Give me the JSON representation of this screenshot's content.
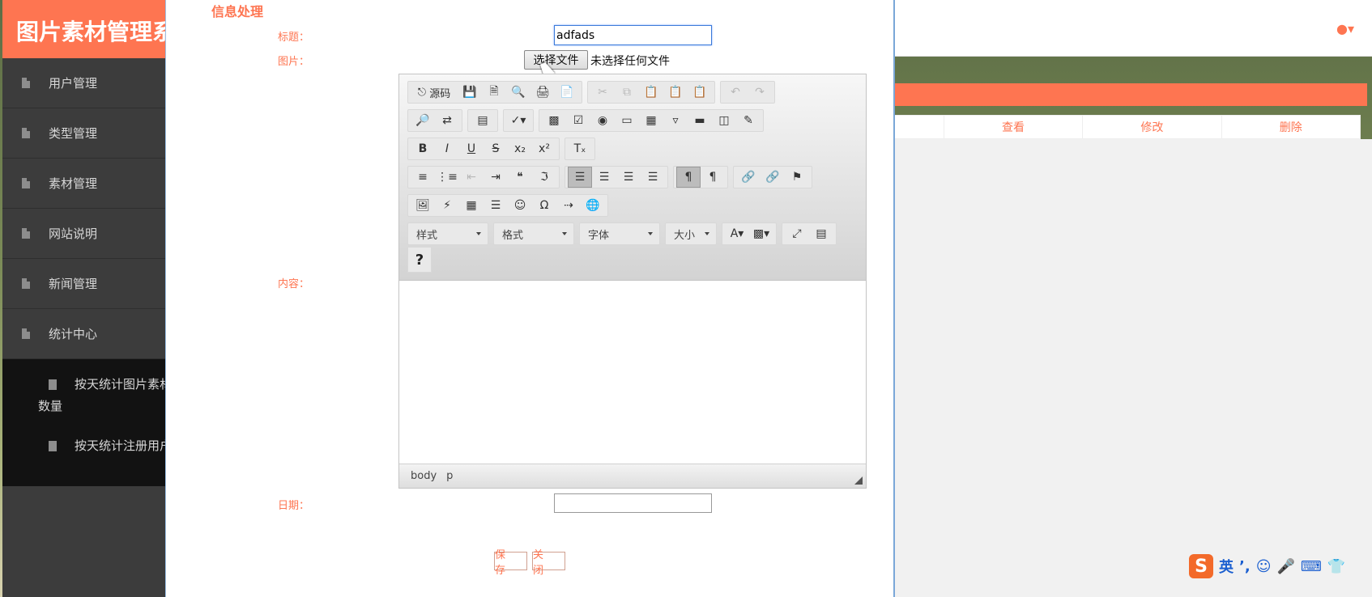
{
  "app": {
    "brand": "图片素材管理系统"
  },
  "sidebar": {
    "items": [
      {
        "label": "用户管理"
      },
      {
        "label": "类型管理"
      },
      {
        "label": "素材管理"
      },
      {
        "label": "网站说明"
      },
      {
        "label": "新闻管理"
      },
      {
        "label": "统计中心"
      }
    ],
    "sub_items": [
      {
        "label_line1": "按天统计图片素材",
        "label_line2": "数量"
      },
      {
        "label_line1": "按天统计注册用户",
        "label_line2": ""
      }
    ]
  },
  "background_table": {
    "headers": [
      "查看",
      "修改",
      "删除"
    ]
  },
  "modal": {
    "title": "信息处理",
    "labels": {
      "title": "标题：",
      "image": "图片：",
      "content": "内容：",
      "date": "日期："
    },
    "title_value": "adfads",
    "file_button": "选择文件",
    "file_status": "未选择任何文件",
    "date_value": "",
    "buttons": {
      "save": "保 存",
      "close": "关 闭"
    }
  },
  "editor": {
    "source_label": "源码",
    "combos": [
      "样式",
      "格式",
      "字体",
      "大小"
    ],
    "help": "?",
    "status_path": [
      "body",
      "p"
    ]
  },
  "ime": {
    "mode": "英"
  },
  "colors": {
    "accent": "#fe7551",
    "sidebar": "#3c3c3c",
    "focus": "#3b7ad9"
  }
}
